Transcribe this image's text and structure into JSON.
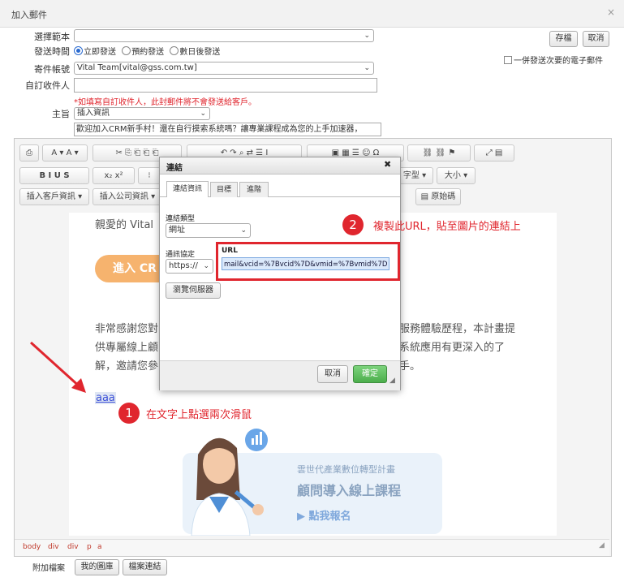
{
  "window": {
    "title": "加入郵件",
    "close": "×"
  },
  "form": {
    "template_label": "選擇範本",
    "template_value": "",
    "send_time_label": "發送時間",
    "send_time_options": [
      "立即發送",
      "預約發送",
      "數日後發送"
    ],
    "sender_label": "寄件帳號",
    "sender_value": "Vital Team[vital@gss.com.tw]",
    "custom_recipient_label": "自訂收件人",
    "custom_recipient_value": "",
    "warning": "*如填寫自訂收件人，此封郵件將不會發送給客戶。",
    "subject_label": "主旨",
    "subject_insert": "插入資訊",
    "subject_value": "歡迎加入CRM新手村！還在自行摸索系統嗎？讓專業課程成為您的上手加速器，",
    "save_button": "存檔",
    "cancel_button": "取消",
    "send_unsent_label": "一併發送次要的電子郵件"
  },
  "toolbar": {
    "font_label": "字型",
    "size_label": "大小",
    "insert_customer": "插入客戶資訊",
    "insert_company": "插入公司資訊",
    "source": "原始碼"
  },
  "document": {
    "greeting": "親愛的 Vital",
    "cta_button": "進入 CR",
    "para_line1_left": "非常感謝您對",
    "para_line1_right": "服務體驗歷程，本計畫提",
    "para_line2_left": "供專屬線上顧",
    "para_line2_right": "系統應用有更深入的了",
    "para_line3_left": "解，邀請您參",
    "para_line3_right": "手。",
    "link_text": "aaa",
    "banner_line1": "雲世代產業數位轉型計畫",
    "banner_line2": "顧問導入線上課程",
    "banner_line3": "▶  點我報名"
  },
  "pathbar": [
    "body",
    "div",
    "div",
    "p",
    "a"
  ],
  "attachments": {
    "label": "附加檔案",
    "my_library": "我的圖庫",
    "file_link": "檔案連結"
  },
  "dialog": {
    "title": "連結",
    "close": "✖",
    "tabs": [
      "連結資訊",
      "目標",
      "進階"
    ],
    "link_type_label": "連結類型",
    "link_type_value": "網址",
    "protocol_label": "通訊協定",
    "protocol_value": "https://",
    "url_label": "URL",
    "url_value": "mail&vcid=%7Bvcid%7D&vmid=%7Bvmid%7D",
    "browse_button": "瀏覽伺服器",
    "cancel_button": "取消",
    "ok_button": "確定"
  },
  "annotations": {
    "step1_number": "1",
    "step1_text": "在文字上點選兩次滑鼠",
    "step2_number": "2",
    "step2_text": "複製此URL，貼至圖片的連結上"
  },
  "colors": {
    "accent_red": "#e0262e",
    "ok_green": "#5cb85c",
    "cta_orange": "#f6b36e",
    "link_blue": "#3b4fd8"
  }
}
